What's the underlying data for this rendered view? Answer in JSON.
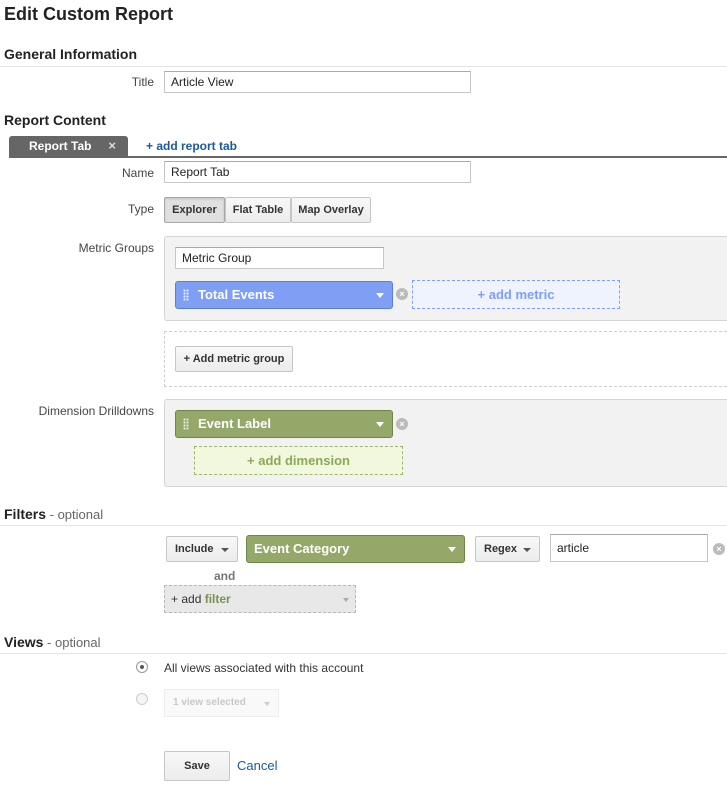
{
  "page": {
    "title": "Edit Custom Report"
  },
  "general": {
    "heading": "General Information",
    "title_label": "Title",
    "title_value": "Article View"
  },
  "content": {
    "heading": "Report Content",
    "tab_label": "Report Tab",
    "tab_close": "×",
    "add_tab_label": "+ add report tab",
    "name_label": "Name",
    "name_value": "Report Tab",
    "type_label": "Type",
    "types": [
      "Explorer",
      "Flat Table",
      "Map Overlay"
    ],
    "metric_groups_label": "Metric Groups",
    "metric_group_name": "Metric Group",
    "metric": "Total Events",
    "add_metric": "+ add metric",
    "add_metric_group": "+ Add metric group",
    "dim_label": "Dimension Drilldowns",
    "dimension": "Event Label",
    "add_dimension": "+ add dimension",
    "colors": {
      "metric": "#7f9ff4",
      "dimension": "#93a869"
    }
  },
  "filters": {
    "heading": "Filters",
    "optional": " - optional",
    "include": "Include",
    "dimension": "Event Category",
    "match": "Regex",
    "value": "article",
    "and": "and",
    "add_prefix": "+ add",
    "add_word": "filter"
  },
  "views": {
    "heading": "Views",
    "optional": " - optional",
    "all_views": "All views associated with this account",
    "view_selected": "1 view selected"
  },
  "actions": {
    "save": "Save",
    "cancel": "Cancel"
  }
}
